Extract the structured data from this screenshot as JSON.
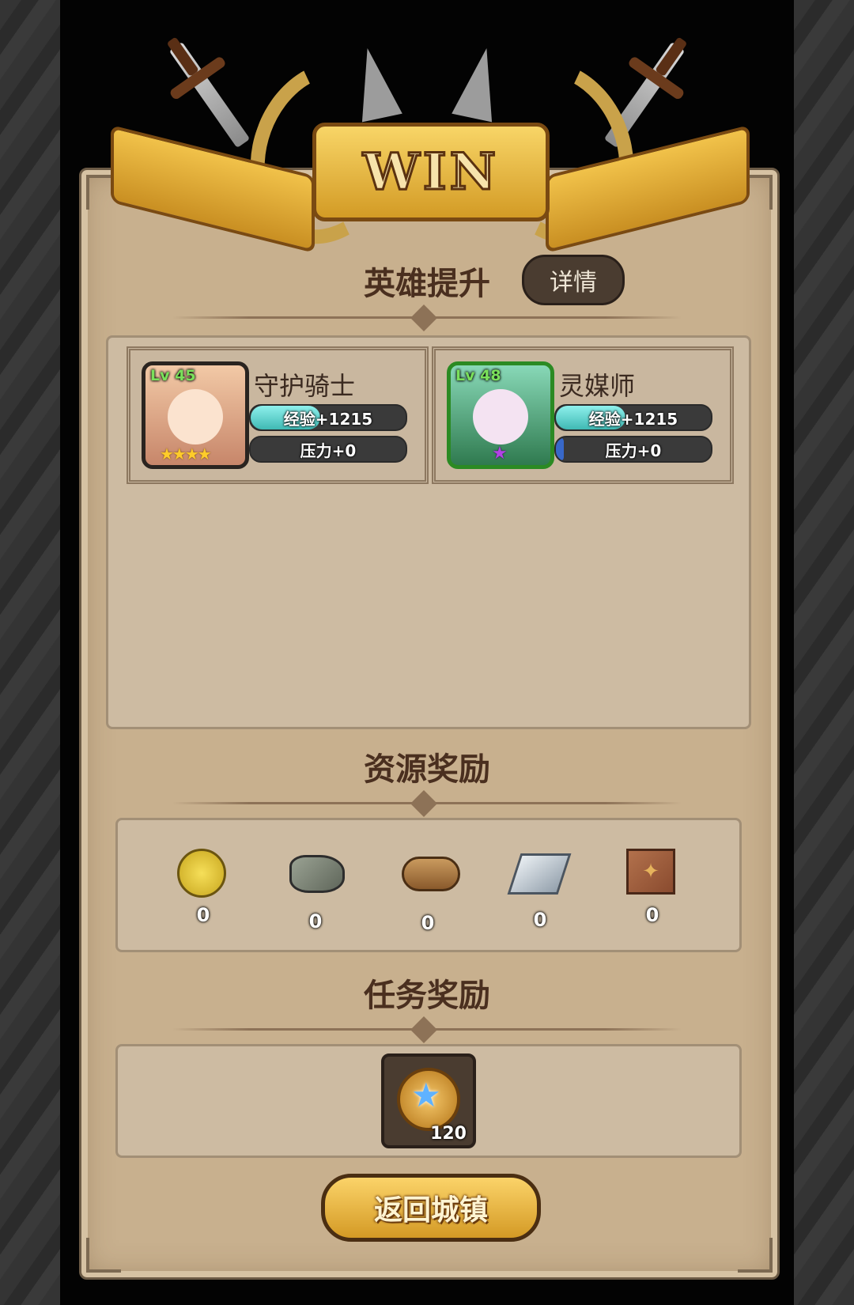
{
  "banner": {
    "text": "WIN"
  },
  "hero_section": {
    "title": "英雄提升",
    "detail_label": "详情",
    "heroes": [
      {
        "name": "守护骑士",
        "level": "Lv 45",
        "exp": "经验+1215",
        "exp_fill": 0.45,
        "stress": "压力+0",
        "stress_fill": 0.0,
        "stars": "★★★★"
      },
      {
        "name": "灵媒师",
        "level": "Lv 48",
        "exp": "经验+1215",
        "exp_fill": 0.45,
        "stress": "压力+0",
        "stress_fill": 0.05,
        "stars": "★"
      }
    ]
  },
  "resource_section": {
    "title": "资源奖励",
    "items": [
      {
        "icon": "gold-coin-icon",
        "value": "0"
      },
      {
        "icon": "stone-icon",
        "value": "0"
      },
      {
        "icon": "wood-log-icon",
        "value": "0"
      },
      {
        "icon": "iron-ingot-icon",
        "value": "0"
      },
      {
        "icon": "leather-cloth-icon",
        "value": "0"
      }
    ]
  },
  "mission_section": {
    "title": "任务奖励",
    "reward": {
      "icon": "star-medal-icon",
      "count": "120"
    }
  },
  "return_button": {
    "label": "返回城镇"
  },
  "colors": {
    "accent_gold": "#d39b25",
    "parchment": "#c8b08e",
    "exp_bar": "#3fb9b4",
    "stress_bar": "#3868c8"
  }
}
